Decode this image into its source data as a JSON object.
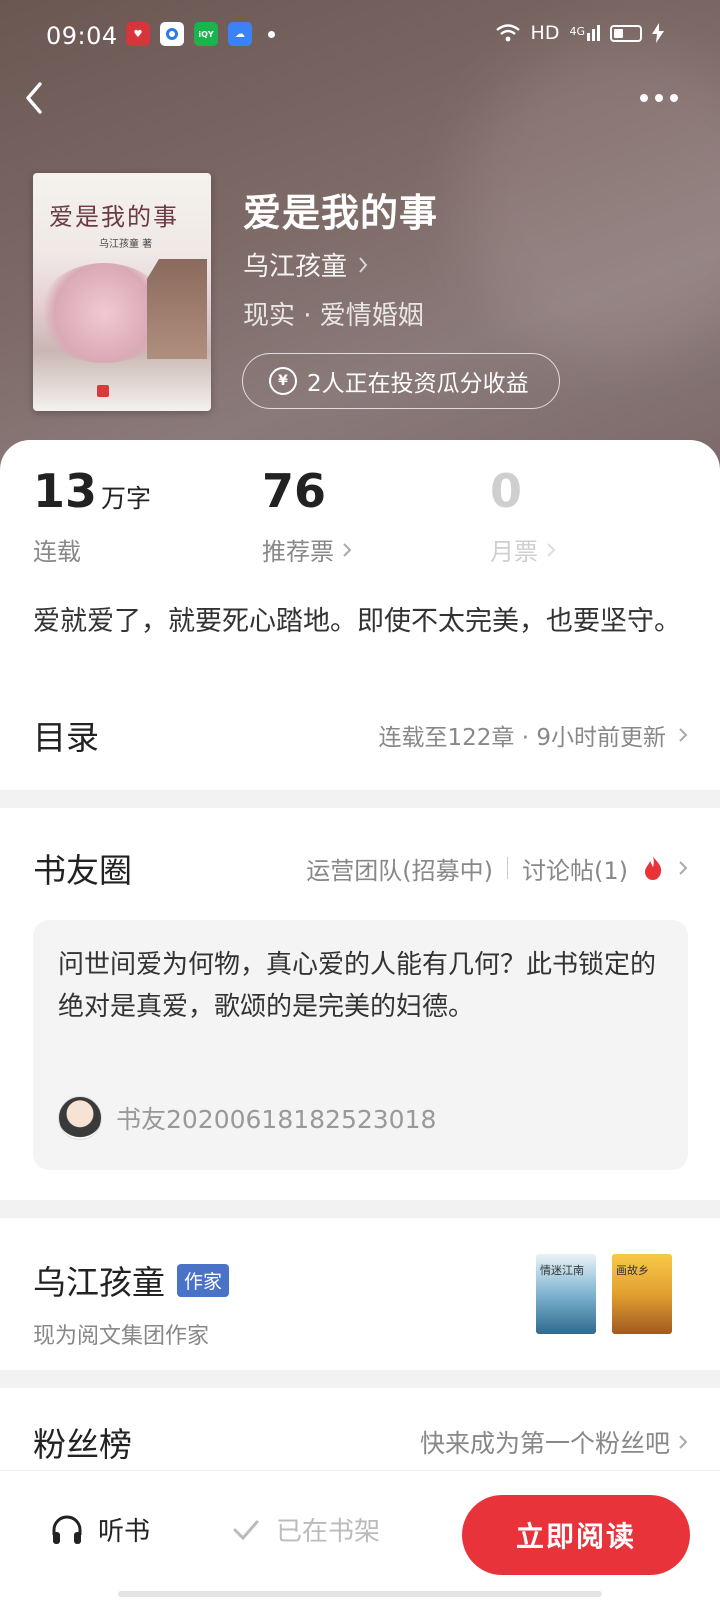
{
  "status_bar": {
    "time": "09:04",
    "apps": [
      {
        "icon": "heart-app-icon",
        "color": "#d8343c"
      },
      {
        "icon": "circle-app-icon",
        "color": "#2a7de1"
      },
      {
        "icon": "video-app-icon",
        "color": "#19b44b",
        "text": "iQIY"
      },
      {
        "icon": "cloud-app-icon",
        "color": "#3b82f6"
      }
    ],
    "hd": "HD",
    "network": "4G"
  },
  "header": {
    "back_icon": "chevron-left-icon",
    "more_icon": "more-dots-icon"
  },
  "book": {
    "cover_title": "爱是我的事",
    "cover_author": "乌江孩童 著",
    "title": "爱是我的事",
    "author": "乌江孩童",
    "genre": "现实 · 爱情婚姻",
    "invest_text": "2人正在投资瓜分收益"
  },
  "stats": {
    "words_value": "13",
    "words_unit": "万字",
    "words_label": "连载",
    "rec_value": "76",
    "rec_label": "推荐票",
    "month_value": "0",
    "month_label": "月票"
  },
  "intro": "爱就爱了，就要死心踏地。即使不太完美，也要坚守。",
  "toc": {
    "title": "目录",
    "meta": "连载至122章 · 9小时前更新"
  },
  "circle": {
    "title": "书友圈",
    "ops_team": "运营团队(招募中)",
    "discussions": "讨论帖(1)",
    "post_text": "问世间爱为何物，真心爱的人能有几何？此书锁定的绝对是真爱，歌颂的是完美的妇德。",
    "post_user": "书友20200618182523018"
  },
  "author_card": {
    "name": "乌江孩童",
    "badge": "作家",
    "subtitle": "现为阅文集团作家",
    "other_books": [
      "情迷江南",
      "画故乡"
    ]
  },
  "fans": {
    "title": "粉丝榜",
    "meta": "快来成为第一个粉丝吧"
  },
  "bottom": {
    "listen": "听书",
    "shelf": "已在书架",
    "read": "立即阅读"
  },
  "colors": {
    "accent": "#e8333b",
    "badge": "#4a72c7",
    "hero": "#7a6764"
  }
}
